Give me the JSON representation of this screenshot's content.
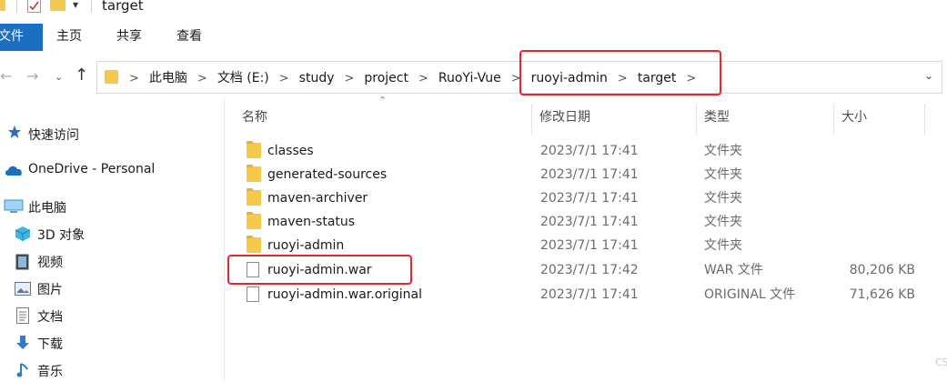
{
  "window": {
    "title": "target"
  },
  "ribbon": {
    "tabs": [
      "文件",
      "主页",
      "共享",
      "查看"
    ]
  },
  "address": {
    "crumbs": [
      "此电脑",
      "文档 (E:)",
      "study",
      "project",
      "RuoYi-Vue",
      "ruoyi-admin",
      "target"
    ]
  },
  "navpane": {
    "items": [
      {
        "label": "快速访问",
        "icon": "star-icon"
      },
      {
        "label": "OneDrive - Personal",
        "icon": "cloud-icon"
      },
      {
        "label": "此电脑",
        "icon": "computer-icon"
      },
      {
        "label": "3D 对象",
        "icon": "cube-icon"
      },
      {
        "label": "视频",
        "icon": "video-icon"
      },
      {
        "label": "图片",
        "icon": "picture-icon"
      },
      {
        "label": "文档",
        "icon": "document-icon"
      },
      {
        "label": "下载",
        "icon": "download-arrow-icon"
      },
      {
        "label": "音乐",
        "icon": "music-note-icon"
      }
    ]
  },
  "columns": {
    "name": "名称",
    "date": "修改日期",
    "type": "类型",
    "size": "大小"
  },
  "files": [
    {
      "name": "classes",
      "date": "2023/7/1 17:41",
      "type": "文件夹",
      "size": "",
      "kind": "folder"
    },
    {
      "name": "generated-sources",
      "date": "2023/7/1 17:41",
      "type": "文件夹",
      "size": "",
      "kind": "folder"
    },
    {
      "name": "maven-archiver",
      "date": "2023/7/1 17:41",
      "type": "文件夹",
      "size": "",
      "kind": "folder"
    },
    {
      "name": "maven-status",
      "date": "2023/7/1 17:41",
      "type": "文件夹",
      "size": "",
      "kind": "folder"
    },
    {
      "name": "ruoyi-admin",
      "date": "2023/7/1 17:41",
      "type": "文件夹",
      "size": "",
      "kind": "folder"
    },
    {
      "name": "ruoyi-admin.war",
      "date": "2023/7/1 17:42",
      "type": "WAR 文件",
      "size": "80,206 KB",
      "kind": "file"
    },
    {
      "name": "ruoyi-admin.war.original",
      "date": "2023/7/1 17:41",
      "type": "ORIGINAL 文件",
      "size": "71,626 KB",
      "kind": "file"
    }
  ],
  "watermark": "CS",
  "colors": {
    "accent": "#1a6fc2",
    "highlight": "#e8262a",
    "folder": "#f7c94a"
  }
}
